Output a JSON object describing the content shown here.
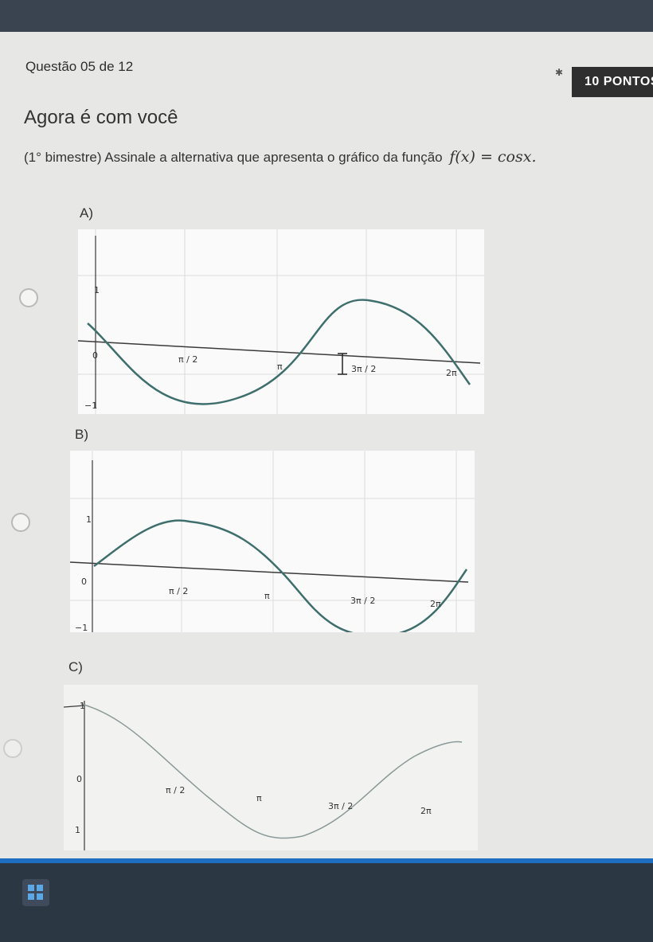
{
  "question": {
    "number_label": "Questão 05 de 12",
    "points_label": "10 PONTOS",
    "heading": "Agora é com você",
    "prompt_text": "(1° bimestre) Assinale a alternativa que apresenta o gráfico da função",
    "formula": "f(x) = cosx."
  },
  "options": [
    {
      "label": "A)",
      "ticks": {
        "one": "1",
        "zero": "0",
        "half_pi": "π / 2",
        "pi": "π",
        "three_half_pi": "3π / 2",
        "two_pi": "2π",
        "minus_one": "−1"
      }
    },
    {
      "label": "B)",
      "ticks": {
        "one": "1",
        "zero": "0",
        "half_pi": "π / 2",
        "pi": "π",
        "three_half_pi": "3π / 2",
        "two_pi": "2π",
        "minus_one": "−1"
      }
    },
    {
      "label": "C)",
      "ticks": {
        "one": "1",
        "zero": "0",
        "half_pi": "π / 2",
        "pi": "π",
        "three_half_pi": "3π / 2",
        "two_pi": "2π",
        "minus_one": "1"
      }
    }
  ],
  "colors": {
    "curve": "#3f6f6d",
    "axis": "#3a3a3a",
    "grid": "#dcdcdc",
    "badge": "#2f2f2f",
    "taskbar_accent": "#1e6fc1"
  },
  "icons": {
    "start": "windows-start-icon"
  }
}
